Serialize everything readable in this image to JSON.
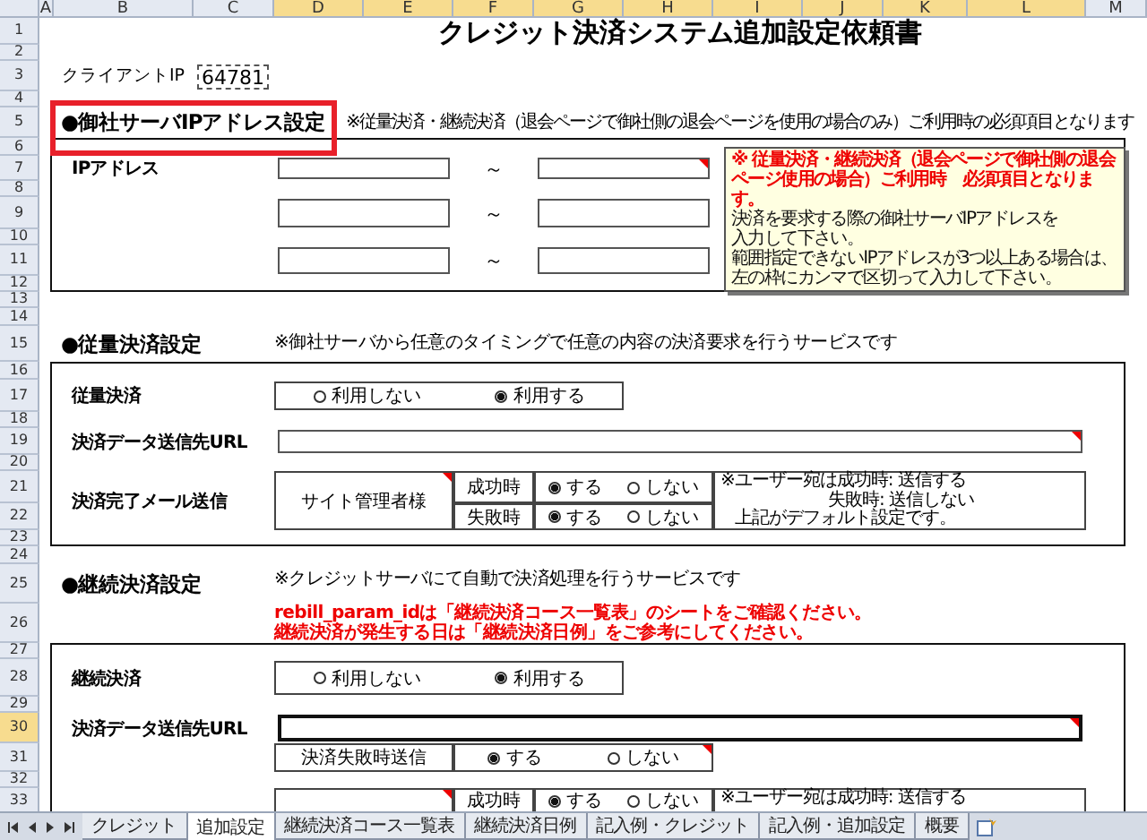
{
  "columns": [
    {
      "label": "A",
      "selected": false
    },
    {
      "label": "B",
      "selected": false
    },
    {
      "label": "C",
      "selected": false
    },
    {
      "label": "D",
      "selected": true
    },
    {
      "label": "E",
      "selected": true
    },
    {
      "label": "F",
      "selected": true
    },
    {
      "label": "G",
      "selected": true
    },
    {
      "label": "H",
      "selected": true
    },
    {
      "label": "I",
      "selected": true
    },
    {
      "label": "J",
      "selected": true
    },
    {
      "label": "K",
      "selected": true
    },
    {
      "label": "L",
      "selected": true
    },
    {
      "label": "M",
      "selected": false
    }
  ],
  "rows": [
    {
      "label": "1",
      "selected": false
    },
    {
      "label": "2",
      "selected": false
    },
    {
      "label": "3",
      "selected": false
    },
    {
      "label": "4",
      "selected": false
    },
    {
      "label": "5",
      "selected": false
    },
    {
      "label": "6",
      "selected": false
    },
    {
      "label": "7",
      "selected": false
    },
    {
      "label": "8",
      "selected": false
    },
    {
      "label": "9",
      "selected": false
    },
    {
      "label": "10",
      "selected": false
    },
    {
      "label": "11",
      "selected": false
    },
    {
      "label": "12",
      "selected": false
    },
    {
      "label": "13",
      "selected": false
    },
    {
      "label": "14",
      "selected": false
    },
    {
      "label": "15",
      "selected": false
    },
    {
      "label": "16",
      "selected": false
    },
    {
      "label": "17",
      "selected": false
    },
    {
      "label": "18",
      "selected": false
    },
    {
      "label": "19",
      "selected": false
    },
    {
      "label": "20",
      "selected": false
    },
    {
      "label": "21",
      "selected": false
    },
    {
      "label": "22",
      "selected": false
    },
    {
      "label": "23",
      "selected": false
    },
    {
      "label": "24",
      "selected": false
    },
    {
      "label": "25",
      "selected": false
    },
    {
      "label": "26",
      "selected": false
    },
    {
      "label": "27",
      "selected": false
    },
    {
      "label": "28",
      "selected": false
    },
    {
      "label": "29",
      "selected": false
    },
    {
      "label": "30",
      "selected": true
    },
    {
      "label": "31",
      "selected": false
    },
    {
      "label": "32",
      "selected": false
    },
    {
      "label": "33",
      "selected": false
    }
  ],
  "title": "クレジット決済システム追加設定依頼書",
  "client": {
    "label": "クライアントIP",
    "value": "64781"
  },
  "ip_section": {
    "heading": "●御社サーバIPアドレス設定",
    "highlighted": true,
    "note": "※従量決済・継続決済（退会ページで御社側の退会ページを使用の場合のみ）ご利用時の必須項目となります",
    "label": "IPアドレス",
    "ranges": [
      {
        "separator": "～",
        "has_comment": true
      },
      {
        "separator": "～",
        "has_comment": false
      },
      {
        "separator": "～",
        "has_comment": false
      }
    ],
    "comment": {
      "warning": "※ 従量決済・継続決済（退会ページで御社側の退会ページ使用の場合）ご利用時　必須項目となります。",
      "lines": [
        "決済を要求する際の御社サーバIPアドレスを",
        "入力して下さい。",
        "範囲指定できないIPアドレスが3つ以上ある場合は、",
        "左の枠にカンマで区切って入力して下さい。"
      ]
    }
  },
  "usage_section": {
    "heading": "●従量決済設定",
    "note": "※御社サーバから任意のタイミングで任意の内容の決済要求を行うサービスです",
    "usage": {
      "label": "従量決済",
      "options": [
        {
          "label": "利用しない",
          "selected": false
        },
        {
          "label": "利用する",
          "selected": true
        }
      ]
    },
    "url": {
      "label": "決済データ送信先URL",
      "has_comment": true,
      "active": false
    },
    "mail": {
      "label": "決済完了メール送信",
      "recipient": "サイト管理者様",
      "has_comment": true,
      "rows": [
        {
          "label": "成功時",
          "options": [
            {
              "label": "する",
              "selected": true
            },
            {
              "label": "しない",
              "selected": false
            }
          ]
        },
        {
          "label": "失敗時",
          "options": [
            {
              "label": "する",
              "selected": true
            },
            {
              "label": "しない",
              "selected": false
            }
          ]
        }
      ],
      "note": [
        "※ユーザー宛は成功時: 送信する",
        "失敗時: 送信しない",
        "上記がデフォルト設定です。"
      ]
    }
  },
  "recurring_section": {
    "heading": "●継続決済設定",
    "note": "※クレジットサーバにて自動で決済処理を行うサービスです",
    "warnings": [
      "rebill_param_idは「継続決済コース一覧表」のシートをご確認ください。",
      "継続決済が発生する日は「継続決済日例」をご参考にしてください。"
    ],
    "recurring": {
      "label": "継続決済",
      "options": [
        {
          "label": "利用しない",
          "selected": false
        },
        {
          "label": "利用する",
          "selected": true
        }
      ]
    },
    "url": {
      "label": "決済データ送信先URL",
      "has_comment": true,
      "active": true
    },
    "failure": {
      "label": "決済失敗時送信",
      "has_comment": true,
      "options": [
        {
          "label": "する",
          "selected": true
        },
        {
          "label": "しない",
          "selected": false
        }
      ]
    },
    "mail": {
      "has_comment": true,
      "rows": [
        {
          "label": "成功時",
          "options": [
            {
              "label": "する",
              "selected": true
            },
            {
              "label": "しない",
              "selected": false
            }
          ]
        }
      ],
      "note": [
        "※ユーザー宛は成功時: 送信する"
      ]
    }
  },
  "sheet_tabs": [
    {
      "label": "クレジット",
      "selected": false
    },
    {
      "label": "追加設定",
      "selected": true
    },
    {
      "label": "継続決済コース一覧表",
      "selected": false
    },
    {
      "label": "継続決済日例",
      "selected": false
    },
    {
      "label": "記入例・クレジット",
      "selected": false
    },
    {
      "label": "記入例・追加設定",
      "selected": false
    },
    {
      "label": "概要",
      "selected": false
    }
  ]
}
